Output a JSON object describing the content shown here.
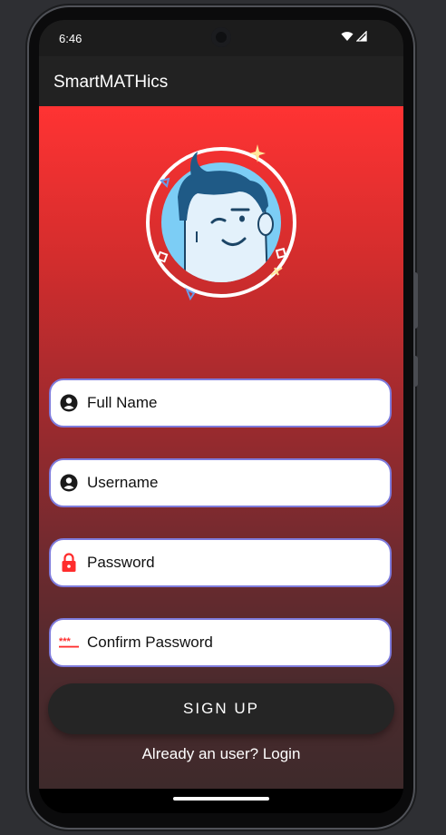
{
  "status_bar": {
    "time": "6:46",
    "icons": [
      "wifi-icon",
      "signal-icon"
    ]
  },
  "app_bar": {
    "title": "SmartMATHics"
  },
  "avatar": {
    "icon": "winking-boy-avatar-icon"
  },
  "form": {
    "full_name": {
      "placeholder": "Full Name",
      "value": "",
      "icon": "person-icon"
    },
    "username": {
      "placeholder": "Username",
      "value": "",
      "icon": "person-icon"
    },
    "password": {
      "placeholder": "Password",
      "value": "",
      "icon": "lock-icon"
    },
    "confirm_password": {
      "placeholder": "Confirm Password",
      "value": "",
      "icon": "password-asterisks-icon"
    }
  },
  "actions": {
    "signup_label": "SIGN UP",
    "login_link": "Already an user? Login"
  },
  "colors": {
    "gradient_top": "#ff3333",
    "gradient_bottom": "#3e2a2b",
    "field_border": "#7e7bdc",
    "button_bg": "#252525",
    "icon_red": "#ff2d2d"
  }
}
